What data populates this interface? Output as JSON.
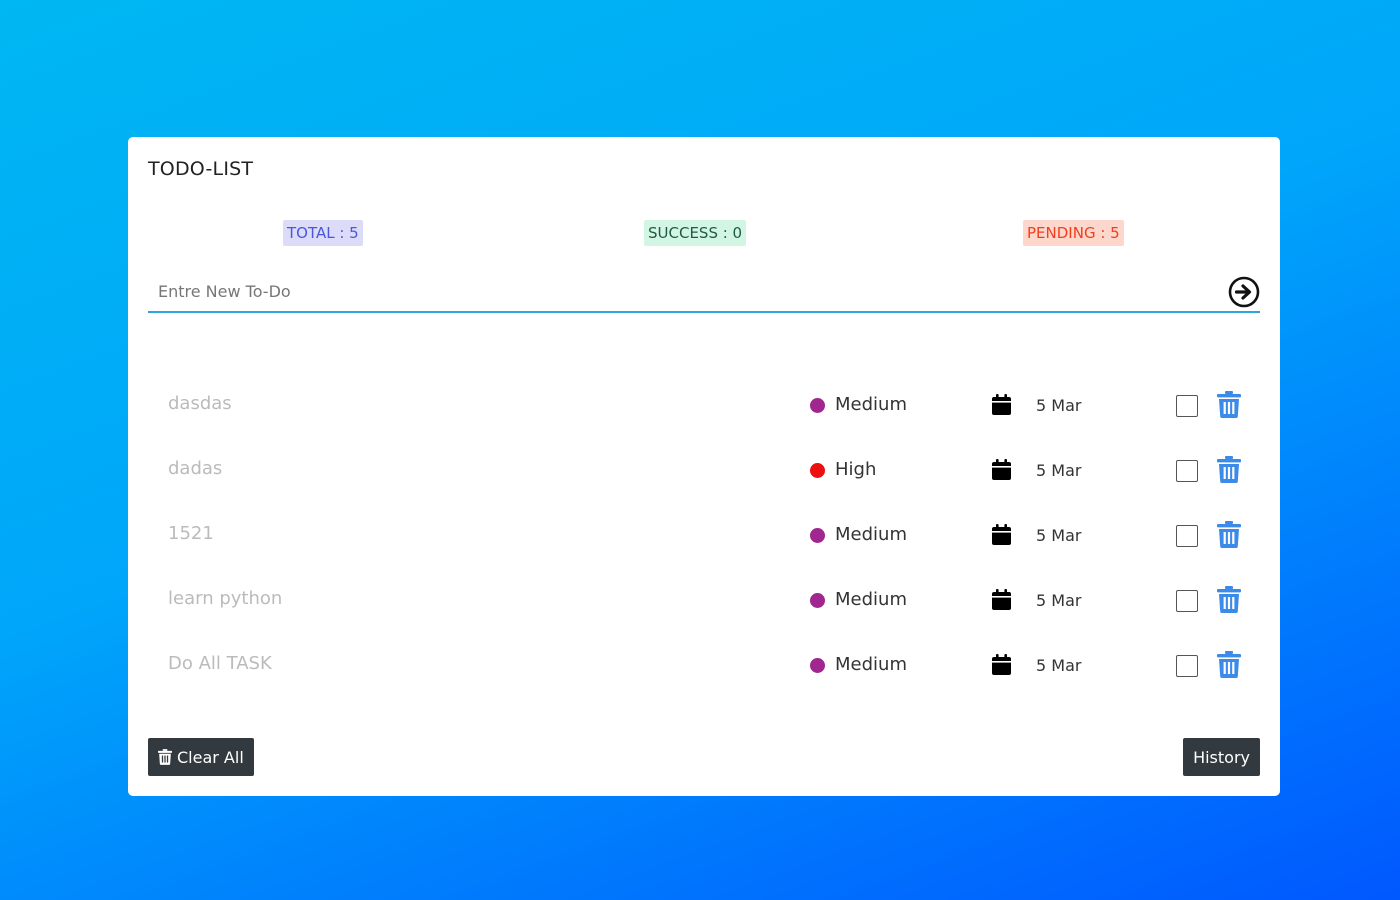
{
  "app": {
    "title": "TODO-LIST"
  },
  "stats": {
    "total_label": "TOTAL : 5",
    "success_label": "SUCCESS : 0",
    "pending_label": "PENDING : 5"
  },
  "input": {
    "placeholder": "Entre New To-Do",
    "value": ""
  },
  "tasks": [
    {
      "name": "dasdas",
      "priority": "Medium",
      "priority_color": "#a0278f",
      "date": "5 Mar",
      "done": false
    },
    {
      "name": "dadas",
      "priority": "High",
      "priority_color": "#ee0f0f",
      "date": "5 Mar",
      "done": false
    },
    {
      "name": "1521",
      "priority": "Medium",
      "priority_color": "#a0278f",
      "date": "5 Mar",
      "done": false
    },
    {
      "name": "learn python",
      "priority": "Medium",
      "priority_color": "#a0278f",
      "date": "5 Mar",
      "done": false
    },
    {
      "name": "Do All TASK",
      "priority": "Medium",
      "priority_color": "#a0278f",
      "date": "5 Mar",
      "done": false
    }
  ],
  "footer": {
    "clear_label": "Clear All",
    "history_label": "History"
  },
  "colors": {
    "accent": "#2fa4df",
    "delete_icon": "#3d8be8",
    "button_bg": "#333a3f"
  },
  "icons": {
    "submit": "arrow-circle-right-icon",
    "calendar": "calendar-icon",
    "delete": "trash-icon",
    "clear": "trash-icon"
  }
}
